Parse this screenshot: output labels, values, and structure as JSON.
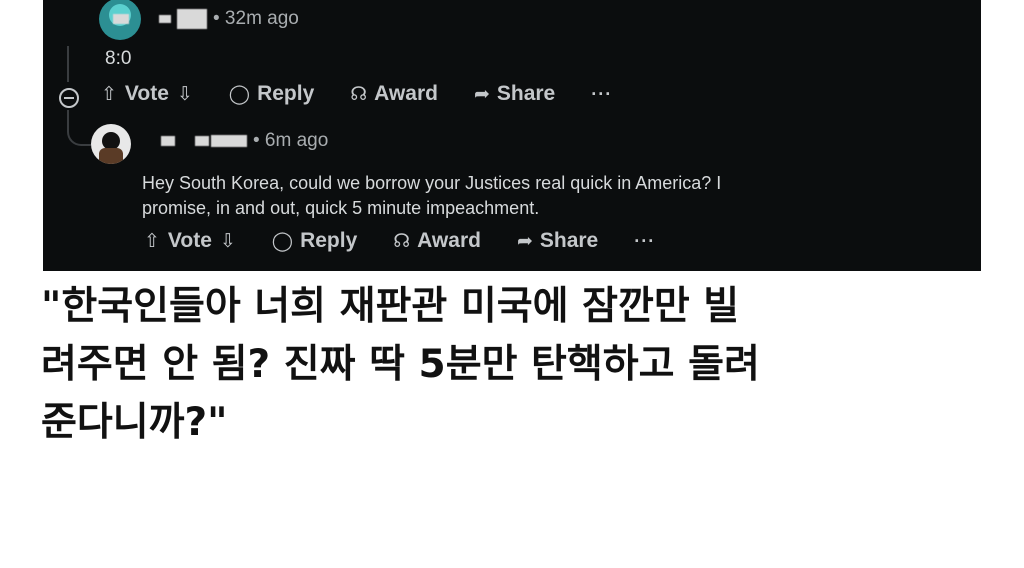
{
  "top_comment": {
    "time": "• 32m ago",
    "body": "8:0",
    "actions": {
      "vote": "Vote",
      "reply": "Reply",
      "award": "Award",
      "share": "Share",
      "more": "···"
    }
  },
  "reply_comment": {
    "time": "• 6m ago",
    "body_line1": "Hey South Korea, could we borrow your Justices real quick in America? I",
    "body_line2": "promise, in and out, quick 5 minute impeachment.",
    "actions": {
      "vote": "Vote",
      "reply": "Reply",
      "award": "Award",
      "share": "Share",
      "more": "···"
    }
  },
  "caption": {
    "line1": "\"한국인들아 너희 재판관 미국에 잠깐만 빌",
    "line2": "려주면 안 됨? 진짜 딱 5분만 탄핵하고 돌려",
    "line3": "준다니까?\""
  },
  "icons": {
    "upvote": "up-arrow-icon",
    "downvote": "down-arrow-icon",
    "reply": "speech-bubble-icon",
    "award": "award-ribbon-icon",
    "share": "share-arrow-icon",
    "collapse": "collapse-minus-icon"
  }
}
